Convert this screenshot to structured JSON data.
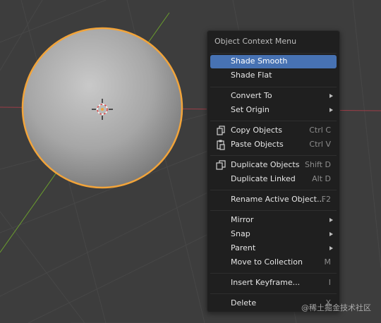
{
  "menu": {
    "title": "Object Context Menu",
    "items": [
      {
        "label": "Shade Smooth",
        "shortcut": "",
        "highlighted": true
      },
      {
        "label": "Shade Flat",
        "shortcut": ""
      },
      {
        "label": "Convert To",
        "shortcut": "",
        "submenu": true
      },
      {
        "label": "Set Origin",
        "shortcut": "",
        "submenu": true
      },
      {
        "label": "Copy Objects",
        "shortcut": "Ctrl C",
        "icon": "copy-icon"
      },
      {
        "label": "Paste Objects",
        "shortcut": "Ctrl V",
        "icon": "paste-icon"
      },
      {
        "label": "Duplicate Objects",
        "shortcut": "Shift D",
        "icon": "duplicate-icon"
      },
      {
        "label": "Duplicate Linked",
        "shortcut": "Alt D"
      },
      {
        "label": "Rename Active Object...",
        "shortcut": "F2"
      },
      {
        "label": "Mirror",
        "shortcut": "",
        "submenu": true
      },
      {
        "label": "Snap",
        "shortcut": "",
        "submenu": true
      },
      {
        "label": "Parent",
        "shortcut": "",
        "submenu": true
      },
      {
        "label": "Move to Collection",
        "shortcut": "M"
      },
      {
        "label": "Insert Keyframe...",
        "shortcut": "I"
      },
      {
        "label": "Delete",
        "shortcut": "X"
      }
    ]
  },
  "colors": {
    "background": "#3d3d3d",
    "grid": "#474747",
    "x_axis": "#9c3d47",
    "y_axis": "#6b9e2e",
    "selection_outline": "#f2a43a",
    "menu_bg": "#1f1f1f",
    "highlight": "#4772b3"
  },
  "watermark": "@稀土掘金技术社区"
}
